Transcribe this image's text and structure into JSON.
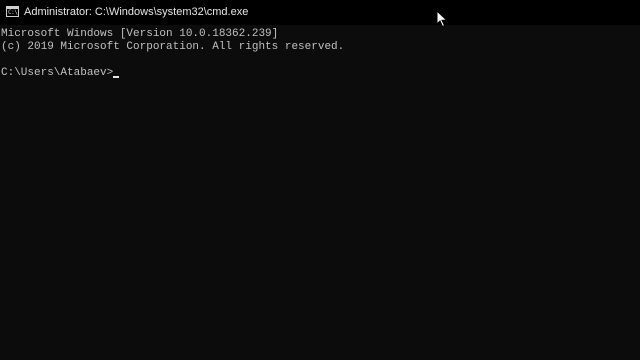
{
  "window": {
    "title": "Administrator: C:\\Windows\\system32\\cmd.exe",
    "icon": "cmd-app-icon",
    "icon_glyph": "C:\\"
  },
  "console": {
    "lines": [
      "Microsoft Windows [Version 10.0.18362.239]",
      "(c) 2019 Microsoft Corporation. All rights reserved."
    ],
    "prompt": "C:\\Users\\Atabaev>"
  },
  "colors": {
    "titlebar_bg": "#000000",
    "console_bg": "#0c0c0c",
    "console_text": "#c0c0c0"
  },
  "mouse_pointer": "arrow-cursor-icon"
}
